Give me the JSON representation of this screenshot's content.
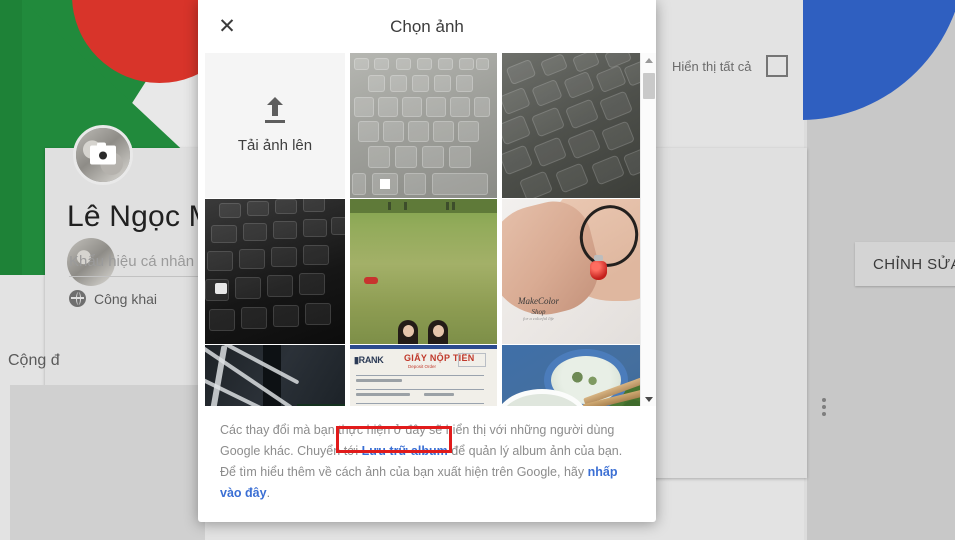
{
  "background": {
    "profile": {
      "name": "Lê Ngọc M",
      "tagline_placeholder": "Khẩu hiệu cá nhân",
      "visibility": "Công khai",
      "visibility_icon": "globe-icon",
      "community_label": "Cộng đ",
      "edit_button": "CHỈNH SỬA H",
      "more_icon": "kebab-menu-icon",
      "avatar_icon": "camera-icon"
    },
    "show_all": {
      "label": "Hiển thị tất cả",
      "checked": false
    },
    "colors": {
      "cover_green": "#218a3c",
      "cover_red": "#d8342a",
      "accent_blue": "#2f5fc0",
      "page_gray": "#e3e3e3"
    }
  },
  "modal": {
    "title": "Chọn ảnh",
    "close_icon": "close-icon",
    "upload": {
      "label": "Tải ảnh lên",
      "icon": "upload-arrow-icon"
    },
    "photos": [
      {
        "alt": "Bàn phím laptop màu xám"
      },
      {
        "alt": "Bàn phím laptop chụp nghiêng"
      },
      {
        "alt": "Bàn phím laptop màu đen"
      },
      {
        "alt": "Hai cô gái ngồi trên bãi cỏ"
      },
      {
        "alt": "Vòng tay charm đỏ MakeColor Shop"
      },
      {
        "alt": "Khung kim loại xe đạp"
      },
      {
        "alt": "Giấy nộp tiền ngân hàng"
      },
      {
        "alt": "Bát canh và đũa"
      }
    ],
    "scrollbar": {
      "up_icon": "scroll-up-arrow-icon",
      "down_icon": "scroll-down-arrow-icon"
    },
    "footer": {
      "part1": "Các thay đổi mà bạn thực hiện ở đây sẽ hiển thị với những người dùng Google khác. Chuyển tới ",
      "link1": "Lưu trữ album",
      "part2": " để quản lý album ảnh của bạn. Để tìm hiểu thêm về cách ảnh của bạn xuất hiện trên Google, hãy ",
      "link2": "nhấp vào đây",
      "part3": ".",
      "highlight_color": "#e11b1b",
      "link_color": "#3b6fd4"
    }
  }
}
